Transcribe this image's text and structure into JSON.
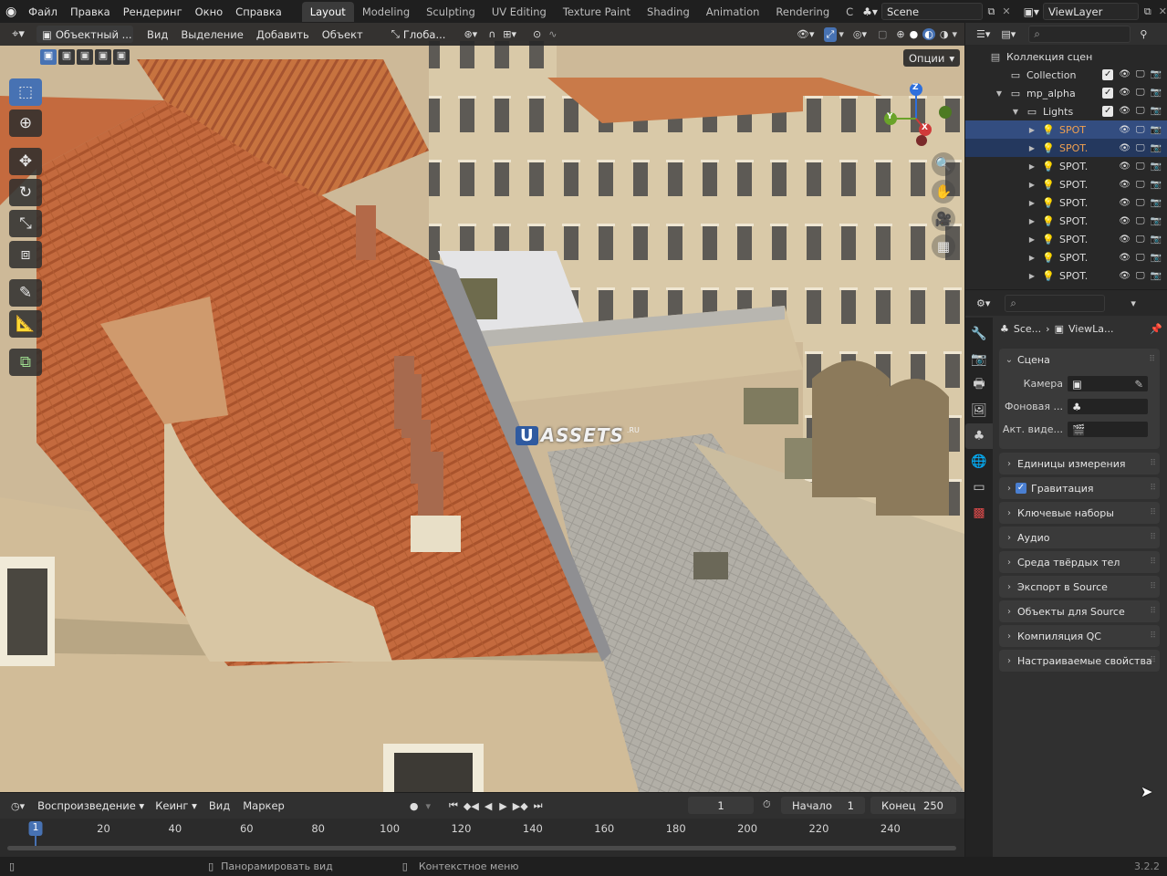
{
  "menus": [
    "Файл",
    "Правка",
    "Рендеринг",
    "Окно",
    "Справка"
  ],
  "workspace_tabs": [
    "Layout",
    "Modeling",
    "Sculpting",
    "UV Editing",
    "Texture Paint",
    "Shading",
    "Animation",
    "Rendering",
    "C"
  ],
  "scene": {
    "name": "Scene"
  },
  "view_layer": {
    "name": "ViewLayer"
  },
  "viewport_header": {
    "mode": "Объектный ...",
    "menus": [
      "Вид",
      "Выделение",
      "Добавить",
      "Объект"
    ],
    "orientation": "Глоба...",
    "options": "Опции"
  },
  "viewport": {
    "watermark": "ASSETS",
    "watermark_badge": "U",
    "watermark_suffix": ".RU",
    "gizmo": {
      "x": "X",
      "y": "Y",
      "z": "Z"
    }
  },
  "outliner": {
    "root": "Коллекция сцен",
    "rows": [
      {
        "label": "Collection",
        "indent": 1,
        "type": "collection",
        "arrow": ""
      },
      {
        "label": "mp_alpha",
        "indent": 1,
        "type": "collection",
        "arrow": "▼"
      },
      {
        "label": "Lights",
        "indent": 2,
        "type": "collection",
        "arrow": "▼"
      },
      {
        "label": "SPOT",
        "indent": 3,
        "type": "light",
        "arrow": "▶",
        "selected": true
      },
      {
        "label": "SPOT.",
        "indent": 3,
        "type": "light",
        "arrow": "▶",
        "selected": true
      },
      {
        "label": "SPOT.",
        "indent": 3,
        "type": "light",
        "arrow": "▶"
      },
      {
        "label": "SPOT.",
        "indent": 3,
        "type": "light",
        "arrow": "▶"
      },
      {
        "label": "SPOT.",
        "indent": 3,
        "type": "light",
        "arrow": "▶"
      },
      {
        "label": "SPOT.",
        "indent": 3,
        "type": "light",
        "arrow": "▶"
      },
      {
        "label": "SPOT.",
        "indent": 3,
        "type": "light",
        "arrow": "▶"
      },
      {
        "label": "SPOT.",
        "indent": 3,
        "type": "light",
        "arrow": "▶"
      },
      {
        "label": "SPOT.",
        "indent": 3,
        "type": "light",
        "arrow": "▶"
      }
    ]
  },
  "properties": {
    "breadcrumb_scene": "Sce...",
    "breadcrumb_viewlayer": "ViewLa...",
    "scene_panel": "Сцена",
    "fields": {
      "camera": "Камера",
      "background": "Фоновая ...",
      "active_clip": "Акт. виде..."
    },
    "panels": [
      "Единицы измерения",
      "Гравитация",
      "Ключевые наборы",
      "Аудио",
      "Среда твёрдых тел",
      "Экспорт в Source",
      "Объекты для Source",
      "Компиляция QC",
      "Настраиваемые свойства"
    ]
  },
  "timeline": {
    "menus": [
      "Воспроизведение",
      "Кеинг",
      "Вид",
      "Маркер"
    ],
    "current_frame": "1",
    "start_label": "Начало",
    "start": "1",
    "end_label": "Конец",
    "end": "250",
    "ruler": [
      "20",
      "40",
      "60",
      "80",
      "100",
      "120",
      "140",
      "160",
      "180",
      "200",
      "220",
      "240"
    ],
    "playhead": "1"
  },
  "statusbar": {
    "pan": "Панорамировать вид",
    "context": "Контекстное меню",
    "version": "3.2.2"
  },
  "colors": {
    "accent": "#4772b3",
    "selected_row": "#334d80",
    "light_name_selected": "#f0a050",
    "roof": "#c46a3e"
  }
}
